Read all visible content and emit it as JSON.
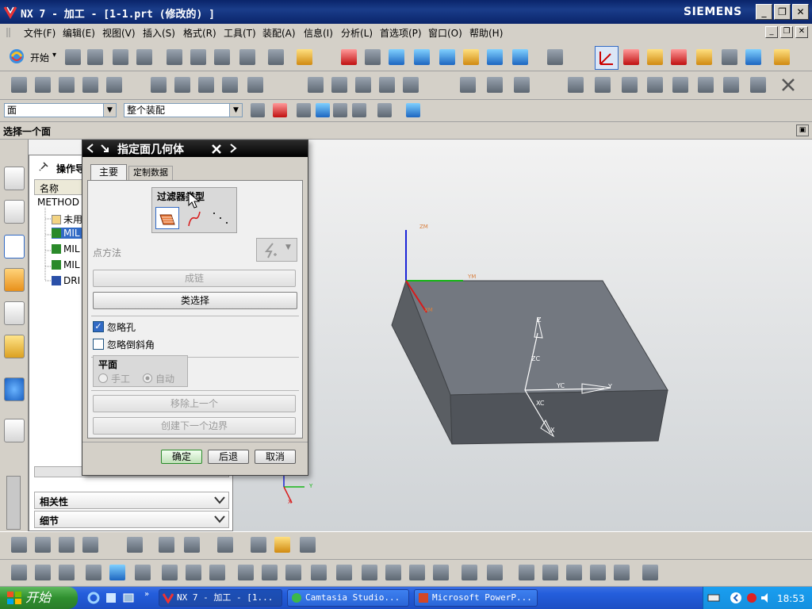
{
  "window": {
    "title": "NX 7 - 加工 - [1-1.prt  (修改的) ]",
    "brand": "SIEMENS",
    "minimize": "_",
    "restore": "❐",
    "close": "✕"
  },
  "menu": [
    "文件(F)",
    "编辑(E)",
    "视图(V)",
    "插入(S)",
    "格式(R)",
    "工具(T)",
    "装配(A)",
    "信息(I)",
    "分析(L)",
    "首选项(P)",
    "窗口(O)",
    "帮助(H)"
  ],
  "toolbar": {
    "start_label": "开始",
    "start_arrow": "▾",
    "filter_select": "面",
    "scope_select": "整个装配"
  },
  "cue_line": "选择一个面",
  "navigator": {
    "header": "操作导",
    "column_name": "名称",
    "items": [
      {
        "label": "METHOD"
      },
      {
        "label": "未用"
      },
      {
        "label": "MIL"
      },
      {
        "label": "MIL"
      },
      {
        "label": "MIL"
      },
      {
        "label": "DRI"
      }
    ],
    "section_dependencies": "相关性",
    "section_details": "细节"
  },
  "dialog": {
    "title": "指定面几何体",
    "tabs": [
      "主要",
      "定制数据"
    ],
    "filter_type_label": "过滤器类型",
    "point_method_label": "点方法",
    "chain_button": "成链",
    "class_select_button": "类选择",
    "ignore_holes": {
      "label": "忽略孔",
      "checked": true
    },
    "ignore_chamfers": {
      "label": "忽略倒斜角",
      "checked": false
    },
    "plane_group": {
      "title": "平面",
      "manual": "手工",
      "auto": "自动"
    },
    "remove_last_button": "移除上一个",
    "create_next_boundary_button": "创建下一个边界",
    "ok_button": "确定",
    "back_button": "后退",
    "cancel_button": "取消"
  },
  "axes": {
    "zc": "ZC",
    "yc": "YC",
    "xc": "XC",
    "x": "X",
    "y": "Y",
    "z": "Z",
    "xm": "XM",
    "ym": "YM",
    "zm": "ZM"
  },
  "taskbar": {
    "start": "开始",
    "tasks": [
      {
        "label": "NX 7 - 加工 - [1..."
      },
      {
        "label": "Camtasia Studio..."
      },
      {
        "label": "Microsoft PowerP..."
      }
    ],
    "clock": "18:53"
  },
  "colors": {
    "titlebar": "#0a246a",
    "dialog_title": "#000000",
    "selected_row": "#316ac5",
    "taskbar": "#245edc",
    "start_green": "#2f8f2f",
    "solid_face": "#6b7076"
  },
  "icons": [
    "nx-logo-icon",
    "window-minimize-icon",
    "window-restore-icon",
    "window-close-icon",
    "start-icon",
    "face-filter-icon",
    "curve-filter-icon",
    "point-filter-icon",
    "point-method-icon",
    "operation-navigator-icon",
    "checkbox-icon",
    "radio-icon"
  ]
}
